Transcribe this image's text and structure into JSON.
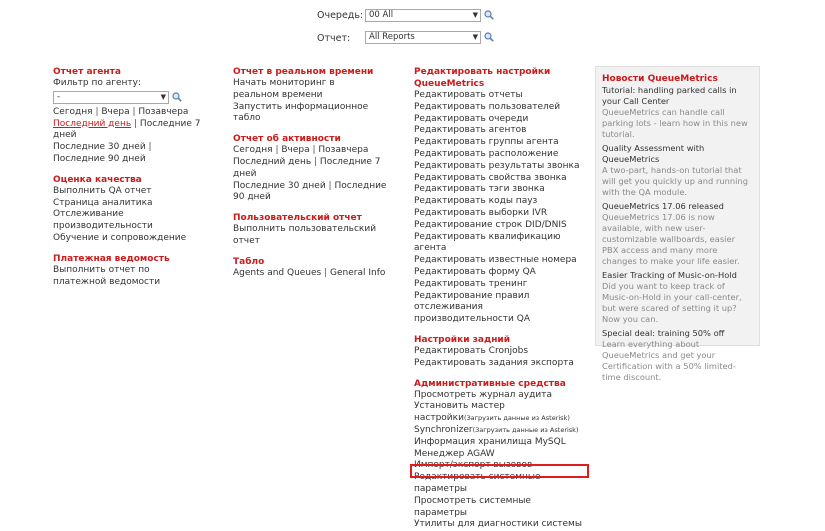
{
  "filters": {
    "queue_label": "Очередь:",
    "queue_value": "00 All",
    "report_label": "Отчет:",
    "report_value": "All Reports"
  },
  "agent_report": {
    "title": "Отчет агента",
    "filter_label": "Фильтр по агенту:",
    "filter_value": "-",
    "today": "Сегодня",
    "yesterday": "Вчера",
    "day_before": "Позавчера",
    "last_day": "Последний день",
    "last_7": "Последние 7 дней",
    "last_30": "Последние 30 дней",
    "last_90": "Последние 90 дней"
  },
  "quality": {
    "title": "Оценка качества",
    "items": [
      "Выполнить QA отчет",
      "Страница аналитика",
      "Отслеживание производительности",
      "Обучение и сопровождение"
    ]
  },
  "payroll": {
    "title": "Платежная ведомость",
    "item": "Выполнить отчет по платежной ведомости"
  },
  "realtime": {
    "title": "Отчет в реальном времени",
    "items": [
      "Начать мониторинг в реальном времени",
      "Запустить информационное табло"
    ]
  },
  "activity": {
    "title": "Отчет об активности",
    "today": "Сегодня",
    "yesterday": "Вчера",
    "day_before": "Позавчера",
    "last_day": "Последний день",
    "last_7": "Последние 7 дней",
    "last_30": "Последние 30 дней",
    "last_90": "Последние 90 дней"
  },
  "custom": {
    "title": "Пользовательский отчет",
    "item": "Выполнить пользовательский отчет"
  },
  "wallboard": {
    "title": "Табло",
    "item1": "Agents and Queues",
    "item2": "General Info"
  },
  "edit_settings": {
    "title": "Редактировать настройки QueueMetrics",
    "items": [
      "Редактировать отчеты",
      "Редактировать пользователей",
      "Редактировать очереди",
      "Редактировать агентов",
      "Редактировать группы агента",
      "Редактировать расположение",
      "Редактировать результаты звонка",
      "Редактировать свойства звонка",
      "Редактировать тэги звонка",
      "Редактировать коды пауз",
      "Редактировать выборки IVR",
      "Редактирование строк DID/DNIS",
      "Редактировать квалификацию агента",
      "Редактировать известные номера",
      "Редактировать форму QA",
      "Редактировать тренинг",
      "Редактирование правил отслеживания производительности QA"
    ]
  },
  "background": {
    "title": "Настройки задний",
    "items": [
      "Редактировать Cronjobs",
      "Редактировать задания экспорта"
    ]
  },
  "admin": {
    "title": "Административные средства",
    "items": [
      "Просмотреть журнал аудита",
      "Установить мастер настройки",
      "Synchronizer",
      "Информация хранилища MySQL",
      "Менеджер AGAW",
      "Импорт/экспорт вызовов",
      "Редактировать системные параметры",
      "Просмотреть системные параметры",
      "Утилиты для диагностики системы"
    ],
    "asterisk_note": "(Загрузить данные из Asterisk)"
  },
  "news": {
    "title": "Новости QueueMetrics",
    "entries": [
      {
        "title": "Tutorial: handling parked calls in your Call Center",
        "desc": "QueueMetrics can handle call parking lots - learn how in this new tutorial."
      },
      {
        "title": "Quality Assessment with QueueMetrics",
        "desc": "A two-part, hands-on tutorial that will get you quickly up and running with the QA module."
      },
      {
        "title": "QueueMetrics 17.06 released",
        "desc": "QueueMetrics 17.06 is now available, with new user-customizable wallboards, easier PBX access and many more changes to make your life easier."
      },
      {
        "title": "Easier Tracking of Music-on-Hold",
        "desc": "Did you want to keep track of Music-on-Hold in your call-center, but were scared of setting it up? Now you can."
      },
      {
        "title": "Special deal: training 50% off",
        "desc": "Learn everything about QueueMetrics and get your Certification with a 50% limited-time discount."
      }
    ]
  },
  "colors": {
    "accent": "#cc1b1b",
    "highlight": "#e01c1c"
  }
}
